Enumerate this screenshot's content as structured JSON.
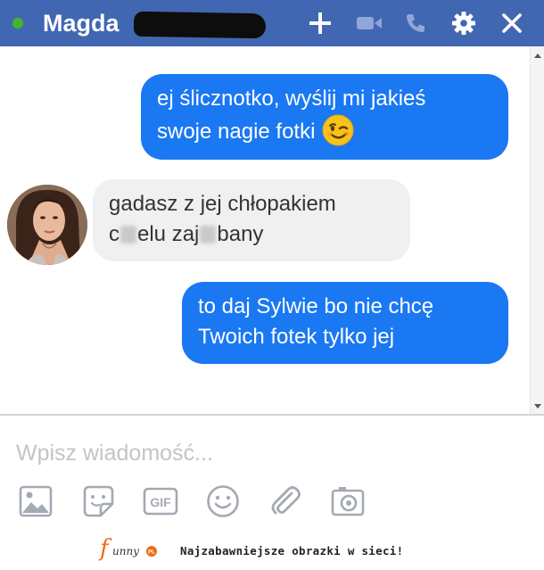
{
  "header": {
    "status": "online",
    "contact_name": "Magda",
    "background": "#4267b2",
    "actions": [
      "add-icon",
      "video-call-icon",
      "phone-icon",
      "gear-icon",
      "close-icon"
    ]
  },
  "messages": [
    {
      "direction": "outgoing",
      "line1": "ej ślicznotko, wyślij mi jakieś",
      "line2": "swoje nagie fotki",
      "emoji": "wink-emoji"
    },
    {
      "direction": "incoming",
      "line1": "gadasz z jej chłopakiem",
      "line2_parts": [
        "c",
        "elu zaj",
        "bany"
      ]
    },
    {
      "direction": "outgoing",
      "line1": "to daj Sylwie bo nie chcę",
      "line2": "Twoich fotek tylko jej"
    }
  ],
  "composer": {
    "placeholder": "Wpisz wiadomość...",
    "tools": [
      "image-icon",
      "sticker-icon",
      "gif-icon",
      "emoji-icon",
      "attachment-icon",
      "camera-icon"
    ],
    "gif_label": "GIF"
  },
  "footer": {
    "logo_text": "funny.pl",
    "tagline": "Najzabawniejsze obrazki w sieci!"
  },
  "colors": {
    "accent": "#4267b2",
    "outgoing_bubble": "#1a78f2",
    "incoming_bubble": "#f1f0f0",
    "online": "#42b72a"
  }
}
